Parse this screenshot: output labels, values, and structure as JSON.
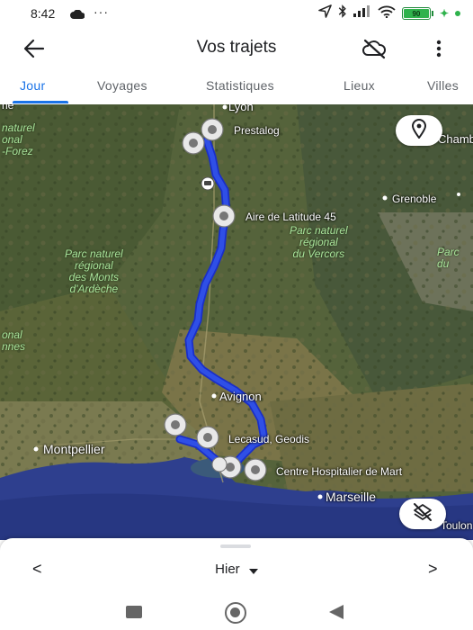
{
  "status_bar": {
    "time": "8:42",
    "dots": "···",
    "battery": "90"
  },
  "header": {
    "title": "Vos trajets"
  },
  "tabs": [
    {
      "label": "Jour"
    },
    {
      "label": "Voyages"
    },
    {
      "label": "Statistiques"
    },
    {
      "label": "Lieux"
    },
    {
      "label": "Villes"
    }
  ],
  "map": {
    "cities": {
      "lyon": "Lyon",
      "grenoble": "Grenoble",
      "avignon": "Avignon",
      "montpellier": "Montpellier",
      "marseille": "Marseille",
      "chambery": "Chamb",
      "toulon": "Toulon"
    },
    "places": {
      "prestalog": "Prestalog",
      "aire": "Aire de Latitude 45",
      "lecasud": "Lecasud, Geodis",
      "hospital": "Centre Hospitalier de Mart"
    },
    "parks": {
      "forez": [
        "naturel",
        "onal",
        "-Forez"
      ],
      "vercors": [
        "Parc naturel",
        "régional",
        "du Vercors"
      ],
      "ardeche": [
        "Parc naturel",
        "régional",
        "des Monts",
        "d'Ardèche"
      ],
      "cevennes": [
        "onal",
        "nnes"
      ],
      "chartreuse": [
        "Parc",
        "du"
      ]
    },
    "fragment_top_left": "ne",
    "colors": {
      "route": "#2f4fe6",
      "route_outline": "#1a2fc8",
      "sea": "#2e3f8e"
    }
  },
  "footer": {
    "prev": "<",
    "date": "Hier",
    "next": ">"
  }
}
